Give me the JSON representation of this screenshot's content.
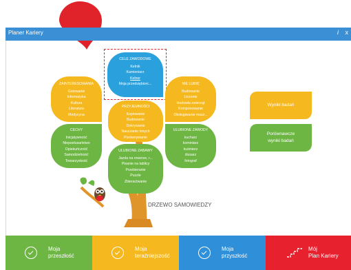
{
  "window": {
    "title": "Planer Kariery",
    "info_glyph": "i",
    "close_glyph": "x"
  },
  "blue_leaf": {
    "title": "CELE ZAWODOWE",
    "items": [
      "Kelnik",
      "Kamieniarz",
      "Kelner",
      "Moja przedsiębiorc..."
    ]
  },
  "left_top": {
    "title": "ZAINTERESOWANIA",
    "items": [
      "Gotowanie",
      "Informatyka",
      "Kultura",
      "Literatura",
      "Medycyna"
    ]
  },
  "right_top": {
    "title": "NIE LUBIĘ",
    "items": [
      "Budowanie",
      "Liczenie",
      "Hodowla zwierząt",
      "Komponowanie",
      "Obsługiwanie masz..."
    ]
  },
  "center": {
    "title": "PRZYJEMNOŚCI",
    "items": [
      "Kopiowanie",
      "Budowanie",
      "Dokrywanie",
      "Nauczanie innych",
      "Porównywanie"
    ]
  },
  "left_mid": {
    "title": "CECHY",
    "items": [
      "Inicjatywność",
      "Niepsełusarlstwo",
      "Opiekuńczość",
      "Samodzielność",
      "Towarzyskość"
    ]
  },
  "right_mid": {
    "title": "ULUBIONE ZAWODY",
    "items": [
      "kucharz",
      "kominiarz",
      "kuśmierz",
      "ślusarz",
      "fotograf"
    ]
  },
  "bottom": {
    "title": "ULUBIONE ZABAWY",
    "items": [
      "Jazda na rowerze, r...",
      "Pisanie na tablicy",
      "Przebieranie",
      "Puzzle",
      "Zbieractwanie"
    ]
  },
  "tree_label": "DRZEWO SAMOWIEDZY",
  "side_buttons": {
    "results": "Wyniki badań",
    "compare_line1": "Porównawcze",
    "compare_line2": "wyniki badań"
  },
  "nav": [
    {
      "line1": "Moja",
      "line2": "przeszłość",
      "color": "#6db643"
    },
    {
      "line1": "Moja",
      "line2": "teraźniejszość",
      "color": "#f5b81f"
    },
    {
      "line1": "Moja",
      "line2": "przyszłość",
      "color": "#2f8fd8"
    },
    {
      "line1": "Mój",
      "line2": "Plan Kariery",
      "color": "#e8212e"
    }
  ]
}
